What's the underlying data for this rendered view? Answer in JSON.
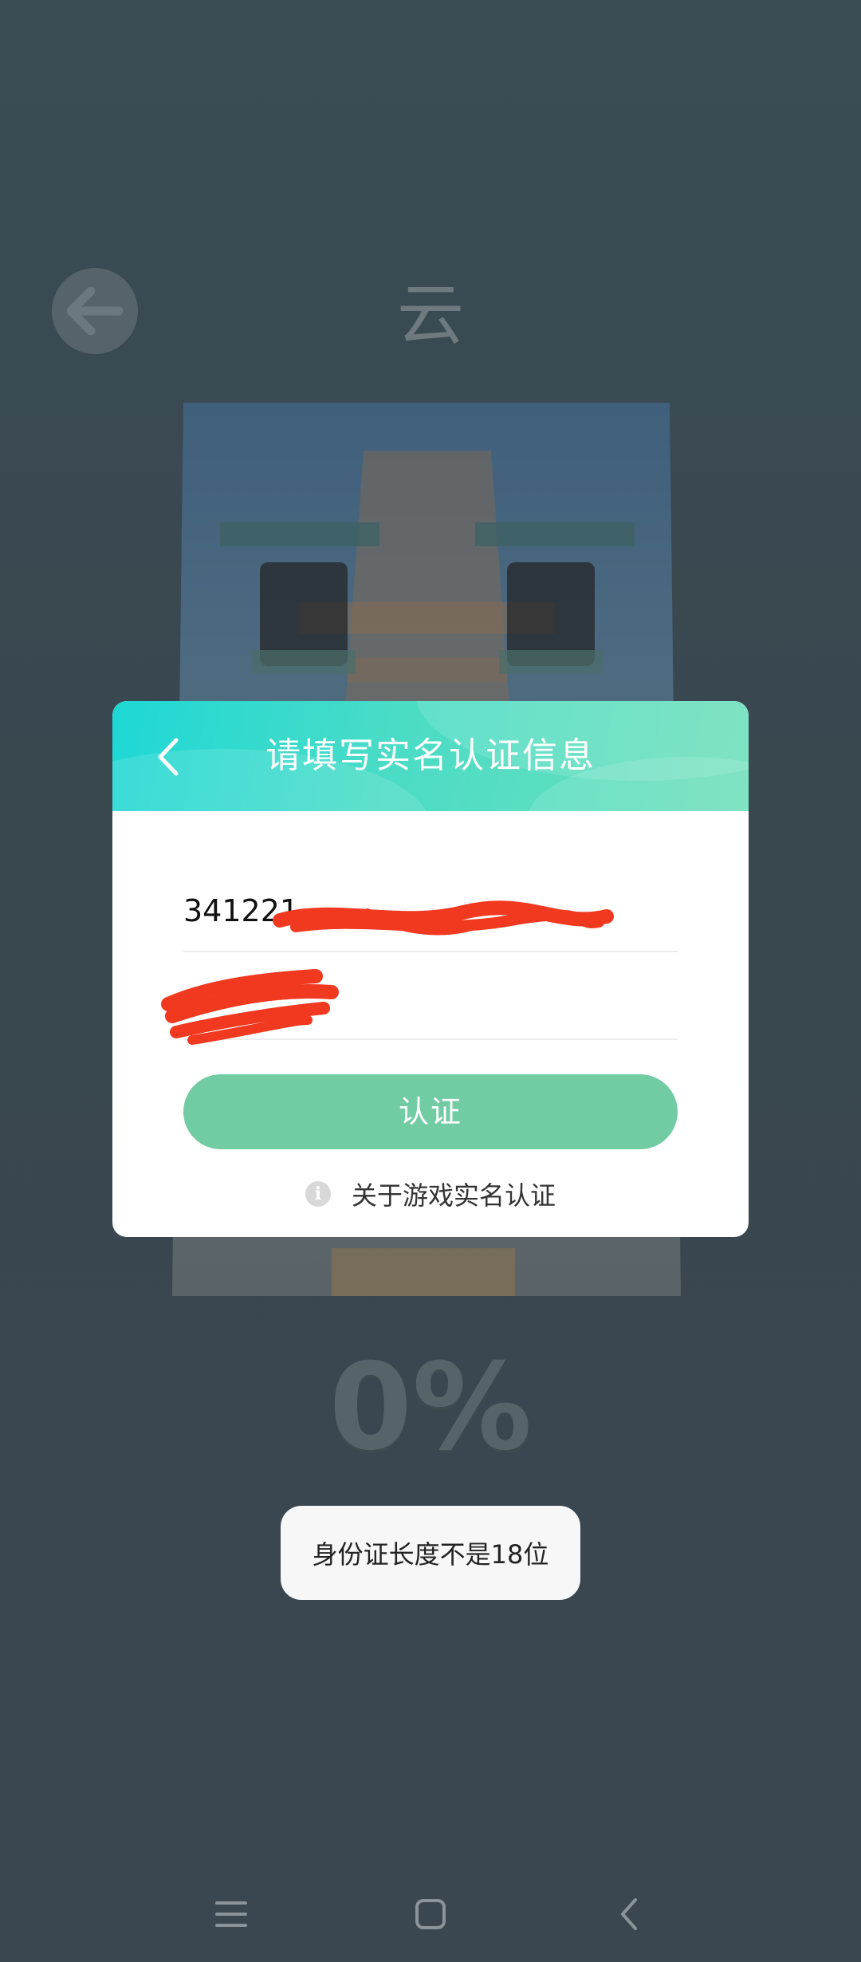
{
  "game": {
    "title": "云",
    "progress_label": "0%",
    "progress": 0
  },
  "dialog": {
    "title": "请填写实名认证信息",
    "id_field_value": "341221",
    "name_field_value": "",
    "submit_label": "认证",
    "info_icon_glyph": "i",
    "info_link_label": "关于游戏实名认证",
    "header_gradient": [
      "#1ed8d5",
      "#6fe0b9"
    ],
    "button_color": "#71cba3"
  },
  "toast": {
    "message": "身份证长度不是18位"
  },
  "navbar": {
    "icons": [
      "menu-icon",
      "home-icon",
      "back-icon"
    ]
  }
}
